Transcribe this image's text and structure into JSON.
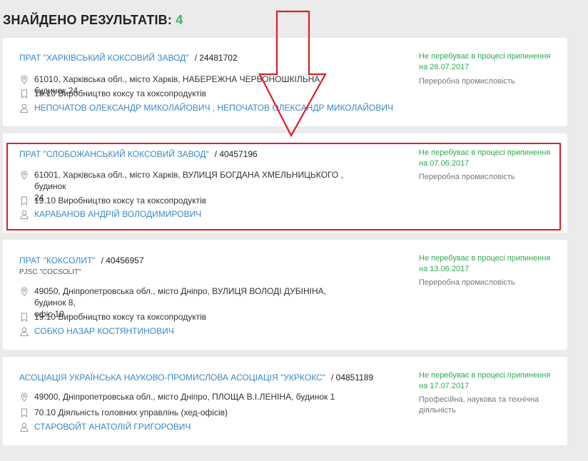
{
  "header": {
    "title": "ЗНАЙДЕНО РЕЗУЛЬТАТІВ:",
    "count": "4"
  },
  "results": [
    {
      "name": "ПРАТ \"ХАРКІВСЬКИЙ КОКСОВИЙ ЗАВОД\"",
      "code": "/ 24481702",
      "alt_name": "",
      "address_line1": "61010, Харківська обл., місто Харків, НАБЕРЕЖНА ЧЕРВОНОШКІЛЬНА, будинок 24",
      "address_line2": "",
      "activity": "19.10 Виробництво коксу та коксопродуктів",
      "persons": "НЕПОЧАТОВ ОЛЕКСАНДР МИКОЛАЙОВИЧ , НЕПОЧАТОВ ОЛЕКСАНДР МИКОЛАЙОВИЧ",
      "status_line1": "Не перебуває в процесі припинення",
      "status_line2": "на 26.07.2017",
      "sector_line1": "Переробна промисловість",
      "sector_line2": ""
    },
    {
      "name": "ПРАТ \"СЛОБОЖАНСЬКИЙ КОКСОВИЙ ЗАВОД\"",
      "code": "/ 40457196",
      "alt_name": "",
      "address_line1": "61001, Харківська обл., місто Харків, ВУЛИЦЯ БОГДАНА ХМЕЛЬНИЦЬКОГО , будинок",
      "address_line2": "24",
      "activity": "19.10 Виробництво коксу та коксопродуктів",
      "persons": "КАРАБАНОВ АНДРІЙ ВОЛОДИМИРОВИЧ",
      "status_line1": "Не перебуває в процесі припинення",
      "status_line2": "на 07.06.2017",
      "sector_line1": "Переробна промисловість",
      "sector_line2": ""
    },
    {
      "name": "ПРАТ \"КОКСОЛИТ\"",
      "code": "/ 40456957",
      "alt_name": "PJSC \"COCSOLIT\"",
      "address_line1": "49050, Дніпропетровська обл., місто Дніпро, ВУЛИЦЯ ВОЛОДІ ДУБІНІНА, будинок 8,",
      "address_line2": "офіс 10",
      "activity": "19.10 Виробництво коксу та коксопродуктів",
      "persons": "СОБКО НАЗАР КОСТЯНТИНОВИЧ",
      "status_line1": "Не перебуває в процесі припинення",
      "status_line2": "на 13.06.2017",
      "sector_line1": "Переробна промисловість",
      "sector_line2": ""
    },
    {
      "name": "АСОЦІАЦІЯ УКРАЇНСЬКА НАУКОВО-ПРОМИСЛОВА АСОЦІАЦІЯ \"УКРКОКС\"",
      "code": "/ 04851189",
      "alt_name": "",
      "address_line1": "49000, Дніпропетровська обл., місто Дніпро, ПЛОЩА В.І.ЛЕНІНА, будинок 1",
      "address_line2": "",
      "activity": "70.10 Діяльність головних управлінь (хед-офісів)",
      "persons": "СТАРОВОЙТ АНАТОЛІЙ ГРИГОРОВИЧ",
      "status_line1": "Не перебуває в процесі припинення",
      "status_line2": "на 17.07.2017",
      "sector_line1": "Професійна, наукова та технічна",
      "sector_line2": "діяльність"
    }
  ],
  "colors": {
    "link": "#3a87c8",
    "status_green": "#2eaa4e",
    "count_green": "#3cb371",
    "highlight_red": "#d8222a",
    "background": "#ebebeb"
  }
}
